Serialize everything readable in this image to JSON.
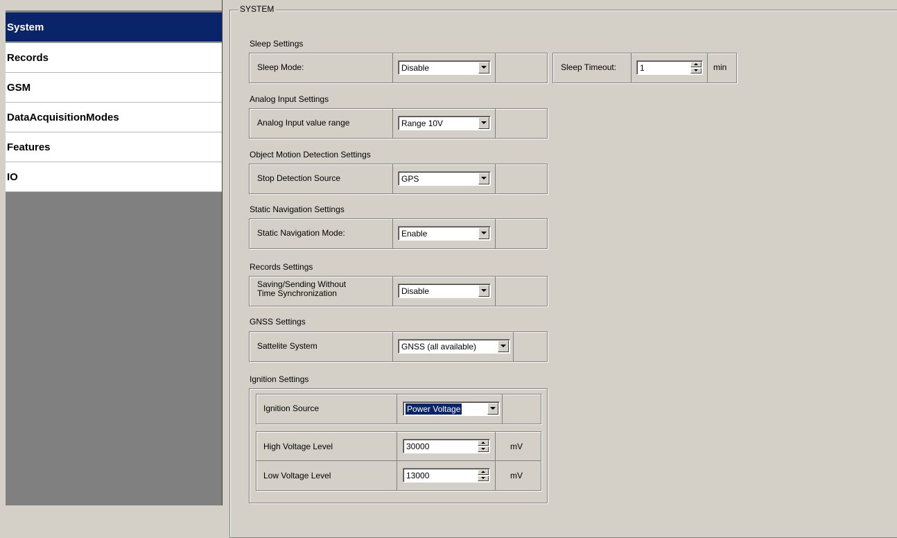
{
  "sidebar": {
    "items": [
      {
        "label": "System",
        "active": true
      },
      {
        "label": "Records"
      },
      {
        "label": "GSM"
      },
      {
        "label": "DataAcquisitionModes"
      },
      {
        "label": "Features"
      },
      {
        "label": "IO"
      }
    ]
  },
  "main": {
    "group_title": "SYSTEM",
    "sleep": {
      "title": "Sleep Settings",
      "mode_label": "Sleep Mode:",
      "mode_value": "Disable",
      "timeout_label": "Sleep Timeout:",
      "timeout_value": "1",
      "timeout_unit": "min"
    },
    "analog": {
      "title": "Analog Input Settings",
      "range_label": "Analog Input value range",
      "range_value": "Range 10V"
    },
    "motion": {
      "title": "Object Motion Detection Settings",
      "source_label": "Stop Detection Source",
      "source_value": "GPS"
    },
    "static_nav": {
      "title": "Static Navigation Settings",
      "mode_label": "Static Navigation Mode:",
      "mode_value": "Enable"
    },
    "records": {
      "title": "Records Settings",
      "saving_label_line1": "Saving/Sending Without",
      "saving_label_line2": "Time Synchronization",
      "saving_value": "Disable"
    },
    "gnss": {
      "title": "GNSS Settings",
      "system_label": "Sattelite System",
      "system_value": "GNSS (all available)"
    },
    "ignition": {
      "title": "Ignition Settings",
      "source_label": "Ignition Source",
      "source_value": "Power Voltage",
      "high_label": "High Voltage Level",
      "high_value": "30000",
      "high_unit": "mV",
      "low_label": "Low Voltage Level",
      "low_value": "13000",
      "low_unit": "mV"
    }
  }
}
